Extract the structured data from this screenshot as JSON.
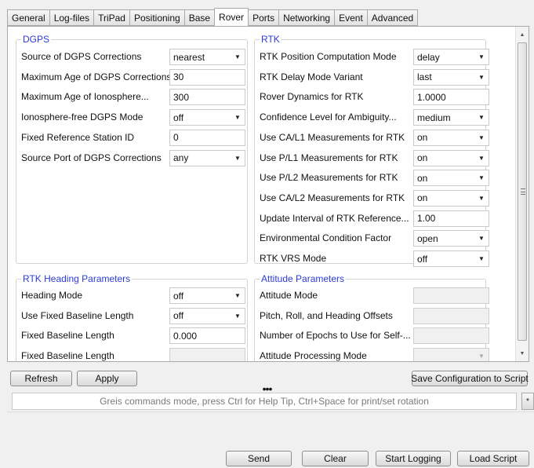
{
  "tabs": [
    "General",
    "Log-files",
    "TriPad",
    "Positioning",
    "Base",
    "Rover",
    "Ports",
    "Networking",
    "Event",
    "Advanced"
  ],
  "active_tab": "Rover",
  "dgps": {
    "title": "DGPS",
    "rows": [
      {
        "label": "Source of DGPS Corrections",
        "type": "combo",
        "value": "nearest"
      },
      {
        "label": "Maximum Age of DGPS Corrections",
        "type": "field",
        "value": "30"
      },
      {
        "label": "Maximum Age of Ionosphere...",
        "type": "field",
        "value": "300"
      },
      {
        "label": "Ionosphere-free DGPS Mode",
        "type": "combo",
        "value": "off"
      },
      {
        "label": "Fixed Reference Station ID",
        "type": "field",
        "value": "0"
      },
      {
        "label": "Source Port of DGPS Corrections",
        "type": "combo",
        "value": "any"
      }
    ]
  },
  "rtk": {
    "title": "RTK",
    "rows": [
      {
        "label": "RTK Position Computation Mode",
        "type": "combo",
        "value": "delay"
      },
      {
        "label": "RTK Delay Mode Variant",
        "type": "combo",
        "value": "last"
      },
      {
        "label": "Rover Dynamics for RTK",
        "type": "field",
        "value": "1.0000"
      },
      {
        "label": "Confidence Level for Ambiguity...",
        "type": "combo",
        "value": "medium"
      },
      {
        "label": "Use CA/L1 Measurements for RTK",
        "type": "combo",
        "value": "on"
      },
      {
        "label": "Use P/L1 Measurements for RTK",
        "type": "combo",
        "value": "on"
      },
      {
        "label": "Use P/L2 Measurements for RTK",
        "type": "combo",
        "value": "on"
      },
      {
        "label": "Use CA/L2 Measurements for RTK",
        "type": "combo",
        "value": "on"
      },
      {
        "label": "Update Interval of RTK Reference...",
        "type": "field",
        "value": "1.00"
      },
      {
        "label": "Environmental Condition Factor",
        "type": "combo",
        "value": "open"
      },
      {
        "label": "RTK VRS Mode",
        "type": "combo",
        "value": "off"
      }
    ]
  },
  "heading": {
    "title": "RTK Heading Parameters",
    "rows": [
      {
        "label": "Heading Mode",
        "type": "combo",
        "value": "off"
      },
      {
        "label": "Use Fixed Baseline Length",
        "type": "combo",
        "value": "off"
      },
      {
        "label": "Fixed Baseline Length",
        "type": "field",
        "value": "0.000"
      },
      {
        "label": "Fixed Baseline Length",
        "type": "field-disabled",
        "value": ""
      }
    ]
  },
  "attitude": {
    "title": "Attitude Parameters",
    "rows": [
      {
        "label": "Attitude Mode",
        "type": "field-disabled",
        "value": ""
      },
      {
        "label": "Pitch, Roll, and Heading Offsets",
        "type": "field-disabled",
        "value": ""
      },
      {
        "label": "Number of Epochs to Use for Self-...",
        "type": "field-disabled",
        "value": ""
      },
      {
        "label": "Attitude Processing Mode",
        "type": "combo-disabled",
        "value": ""
      }
    ]
  },
  "buttons": {
    "refresh": "Refresh",
    "apply": "Apply",
    "save_config": "Save Configuration to Script",
    "send": "Send",
    "clear": "Clear",
    "start_logging": "Start Logging",
    "load_script": "Load Script"
  },
  "command": {
    "hint": "Greis commands mode, press Ctrl for Help Tip, Ctrl+Space for print/set rotation",
    "side_glyph": "*"
  },
  "splitter_glyph": "•••",
  "scroll": {
    "up": "▲",
    "down": "▼",
    "combo_arrow": "▼"
  }
}
